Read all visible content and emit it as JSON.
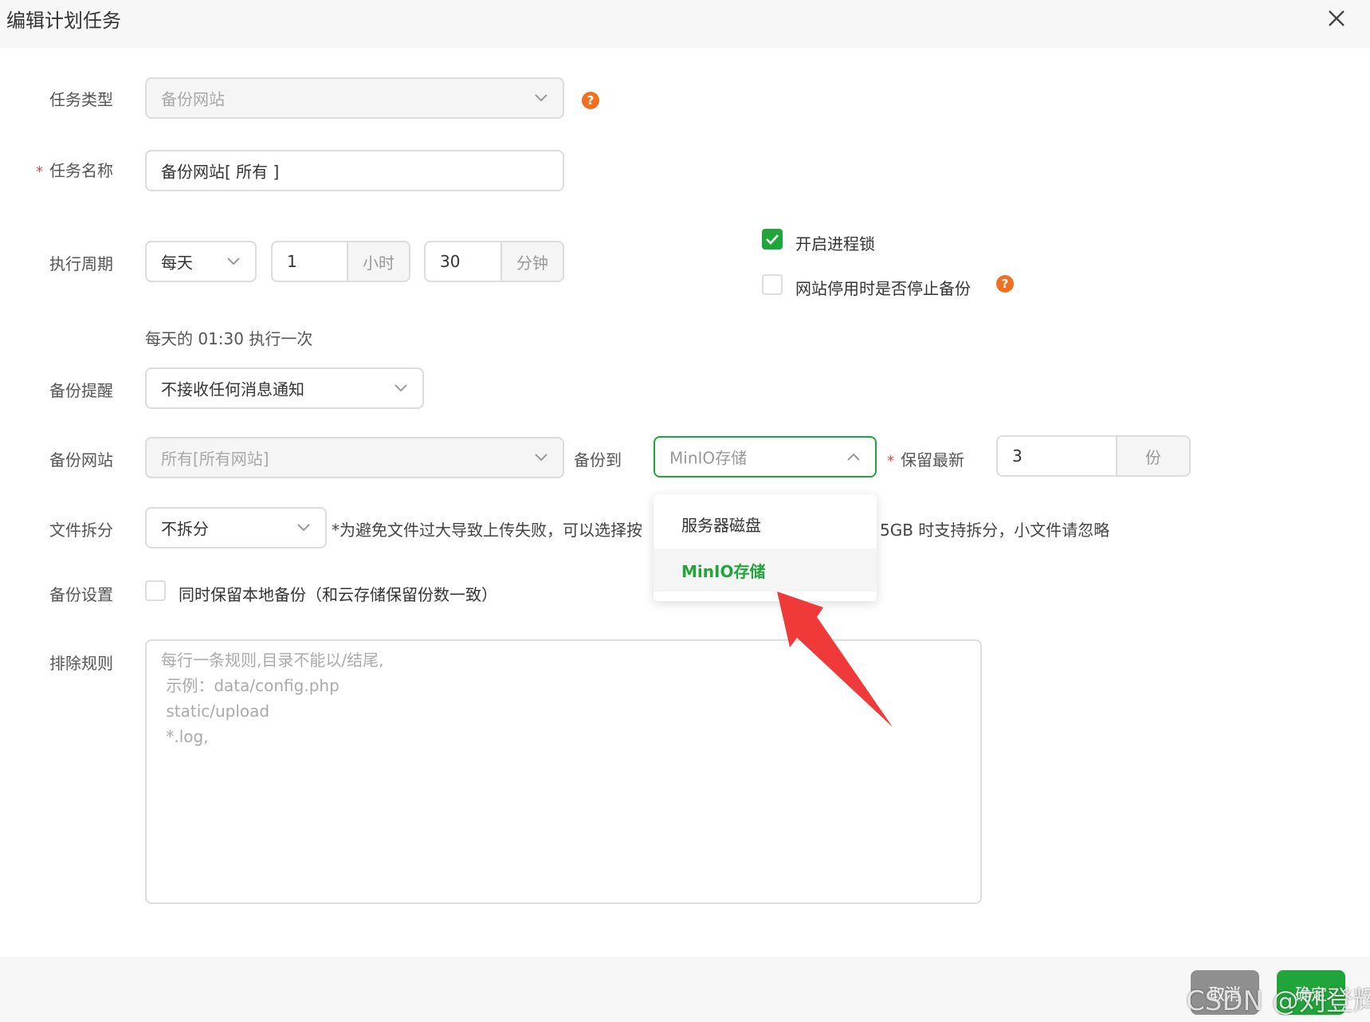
{
  "dialog": {
    "title": "编辑计划任务"
  },
  "task_type": {
    "label": "任务类型",
    "value": "备份网站"
  },
  "task_name": {
    "label": "任务名称",
    "required_mark": "*",
    "value": "备份网站[ 所有 ]"
  },
  "cycle": {
    "label": "执行周期",
    "period": "每天",
    "hour_value": "1",
    "hour_unit": "小时",
    "minute_value": "30",
    "minute_unit": "分钟",
    "summary": "每天的 01:30 执行一次"
  },
  "options": {
    "process_lock": {
      "label": "开启进程锁",
      "checked": true
    },
    "stop_on_disable": {
      "label": "网站停用时是否停止备份",
      "checked": false
    }
  },
  "notify": {
    "label": "备份提醒",
    "value": "不接收任何消息通知"
  },
  "backup_site": {
    "label": "备份网站",
    "value": "所有[所有网站]",
    "target_label": "备份到",
    "target_value": "MinIO存储",
    "retain_label": "保留最新",
    "retain_required_mark": "*",
    "retain_value": "3",
    "retain_unit": "份"
  },
  "target_dropdown": {
    "options": [
      "服务器磁盘",
      "MinIO存储"
    ],
    "selected": "MinIO存储"
  },
  "split": {
    "label": "文件拆分",
    "value": "不拆分",
    "hint_left": "*为避免文件过大导致上传失败，可以选择按",
    "hint_right": "5GB 时支持拆分，小文件请忽略"
  },
  "backup_settings": {
    "label": "备份设置",
    "checkbox_label": "同时保留本地备份（和云存储保留份数一致）",
    "checked": false
  },
  "exclude": {
    "label": "排除规则",
    "placeholder_lines": [
      "每行一条规则,目录不能以/结尾,",
      " 示例：data/config.php",
      " static/upload",
      " *.log,"
    ]
  },
  "footer": {
    "cancel_label": "取消",
    "confirm_label": "确定"
  },
  "watermark": "CSDN @刘登辉",
  "colors": {
    "accent": "#20a53a",
    "help": "#f07022",
    "arrow": "#f03a3a"
  }
}
